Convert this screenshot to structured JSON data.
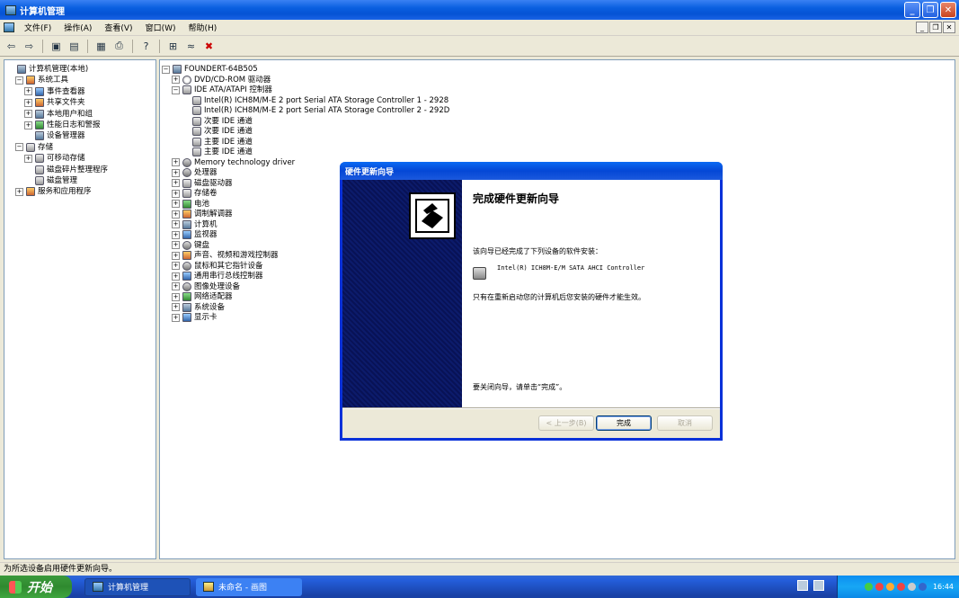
{
  "window": {
    "title": "计算机管理"
  },
  "menu": [
    "文件(F)",
    "操作(A)",
    "查看(V)",
    "窗口(W)",
    "帮助(H)"
  ],
  "left_tree": [
    {
      "label": "计算机管理(本地)",
      "indent": 0,
      "exp": "",
      "icon": "comp"
    },
    {
      "label": "系统工具",
      "indent": 1,
      "exp": "−",
      "icon": "tool"
    },
    {
      "label": "事件查看器",
      "indent": 2,
      "exp": "+",
      "icon": "blue"
    },
    {
      "label": "共享文件夹",
      "indent": 2,
      "exp": "+",
      "icon": "tool"
    },
    {
      "label": "本地用户和组",
      "indent": 2,
      "exp": "+",
      "icon": "comp"
    },
    {
      "label": "性能日志和警报",
      "indent": 2,
      "exp": "+",
      "icon": "green"
    },
    {
      "label": "设备管理器",
      "indent": 2,
      "exp": "",
      "icon": "comp"
    },
    {
      "label": "存储",
      "indent": 1,
      "exp": "−",
      "icon": "disk"
    },
    {
      "label": "可移动存储",
      "indent": 2,
      "exp": "+",
      "icon": "disk"
    },
    {
      "label": "磁盘碎片整理程序",
      "indent": 2,
      "exp": "",
      "icon": "disk"
    },
    {
      "label": "磁盘管理",
      "indent": 2,
      "exp": "",
      "icon": "disk"
    },
    {
      "label": "服务和应用程序",
      "indent": 1,
      "exp": "+",
      "icon": "tool"
    }
  ],
  "right_tree": [
    {
      "label": "FOUNDERT-64B505",
      "indent": 0,
      "exp": "−",
      "icon": "comp"
    },
    {
      "label": "DVD/CD-ROM 驱动器",
      "indent": 1,
      "exp": "+",
      "icon": "cd"
    },
    {
      "label": "IDE ATA/ATAPI 控制器",
      "indent": 1,
      "exp": "−",
      "icon": "disk"
    },
    {
      "label": "Intel(R) ICH8M/M-E 2 port Serial ATA Storage Controller 1 - 2928",
      "indent": 2,
      "exp": "",
      "icon": "disk"
    },
    {
      "label": "Intel(R) ICH8M/M-E 2 port Serial ATA Storage Controller 2 - 292D",
      "indent": 2,
      "exp": "",
      "icon": "disk"
    },
    {
      "label": "次要 IDE 通道",
      "indent": 2,
      "exp": "",
      "icon": "disk"
    },
    {
      "label": "次要 IDE 通道",
      "indent": 2,
      "exp": "",
      "icon": "disk"
    },
    {
      "label": "主要 IDE 通道",
      "indent": 2,
      "exp": "",
      "icon": "disk"
    },
    {
      "label": "主要 IDE 通道",
      "indent": 2,
      "exp": "",
      "icon": "disk"
    },
    {
      "label": "Memory technology driver",
      "indent": 1,
      "exp": "+",
      "icon": "gear"
    },
    {
      "label": "处理器",
      "indent": 1,
      "exp": "+",
      "icon": "gear"
    },
    {
      "label": "磁盘驱动器",
      "indent": 1,
      "exp": "+",
      "icon": "disk"
    },
    {
      "label": "存储卷",
      "indent": 1,
      "exp": "+",
      "icon": "disk"
    },
    {
      "label": "电池",
      "indent": 1,
      "exp": "+",
      "icon": "green"
    },
    {
      "label": "调制解调器",
      "indent": 1,
      "exp": "+",
      "icon": "tool"
    },
    {
      "label": "计算机",
      "indent": 1,
      "exp": "+",
      "icon": "comp"
    },
    {
      "label": "监视器",
      "indent": 1,
      "exp": "+",
      "icon": "blue"
    },
    {
      "label": "键盘",
      "indent": 1,
      "exp": "+",
      "icon": "gear"
    },
    {
      "label": "声音、视频和游戏控制器",
      "indent": 1,
      "exp": "+",
      "icon": "tool"
    },
    {
      "label": "鼠标和其它指针设备",
      "indent": 1,
      "exp": "+",
      "icon": "gear"
    },
    {
      "label": "通用串行总线控制器",
      "indent": 1,
      "exp": "+",
      "icon": "blue"
    },
    {
      "label": "图像处理设备",
      "indent": 1,
      "exp": "+",
      "icon": "gear"
    },
    {
      "label": "网络适配器",
      "indent": 1,
      "exp": "+",
      "icon": "green"
    },
    {
      "label": "系统设备",
      "indent": 1,
      "exp": "+",
      "icon": "comp"
    },
    {
      "label": "显示卡",
      "indent": 1,
      "exp": "+",
      "icon": "blue"
    }
  ],
  "status": "为所选设备启用硬件更新向导。",
  "dialog": {
    "title": "硬件更新向导",
    "heading": "完成硬件更新向导",
    "intro": "该向导已经完成了下列设备的软件安装：",
    "device": "Intel(R) ICH8M-E/M SATA AHCI Controller",
    "note": "只有在重新启动您的计算机后您安装的硬件才能生效。",
    "close_hint": "要关闭向导，请单击“完成”。",
    "back_label": "< 上一步(B)",
    "finish_label": "完成",
    "cancel_label": "取消"
  },
  "taskbar": {
    "start_label": "开始",
    "task1": "计算机管理",
    "task2": "未命名 - 画图",
    "clock": "16:44"
  }
}
